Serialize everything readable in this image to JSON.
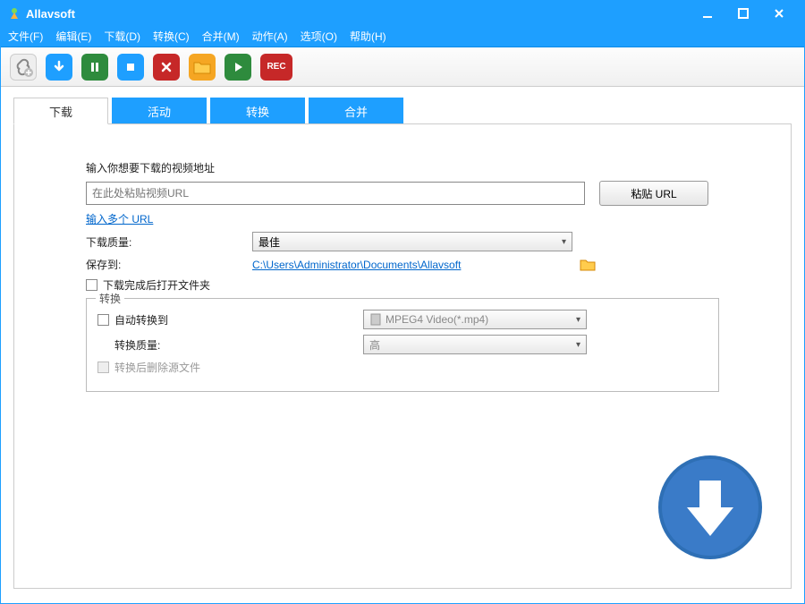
{
  "title": "Allavsoft",
  "menus": {
    "file": "文件(F)",
    "edit": "编辑(E)",
    "download": "下载(D)",
    "convert": "转换(C)",
    "merge": "合并(M)",
    "action": "动作(A)",
    "option": "选项(O)",
    "help": "帮助(H)"
  },
  "tabs": {
    "download": "下载",
    "activity": "活动",
    "convert": "转换",
    "merge": "合并"
  },
  "panel": {
    "url_prompt": "输入你想要下载的视频地址",
    "url_placeholder": "在此处粘贴视频URL",
    "paste_btn": "粘贴 URL",
    "multi_url": "输入多个 URL",
    "quality_label": "下载质量:",
    "quality_value": "最佳",
    "saveto_label": "保存到:",
    "saveto_path": "C:\\Users\\Administrator\\Documents\\Allavsoft",
    "open_folder_after": "下载完成后打开文件夹",
    "convert_legend": "转换",
    "auto_convert": "自动转换到",
    "format_value": "MPEG4 Video(*.mp4)",
    "convert_quality_label": "转换质量:",
    "convert_quality_value": "高",
    "delete_source": "转换后删除源文件"
  },
  "rec_label": "REC"
}
